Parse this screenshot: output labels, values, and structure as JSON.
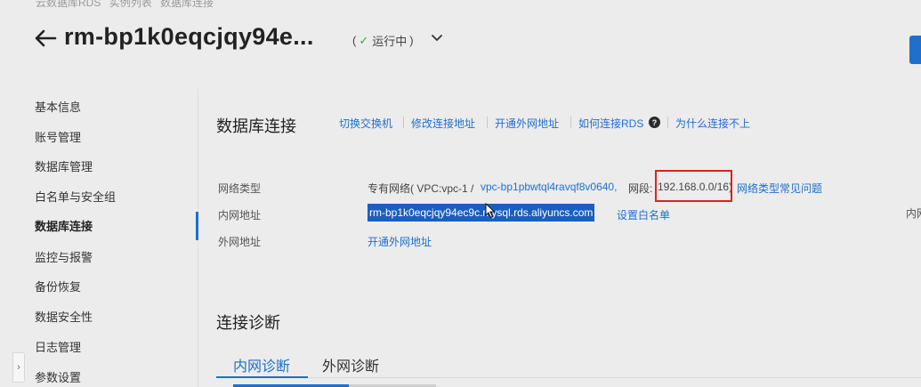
{
  "breadcrumb": [
    "云数据库RDS",
    "实例列表",
    "数据库连接"
  ],
  "header": {
    "title": "rm-bp1k0eqcjqy94e...",
    "status_prefix": "(",
    "status_label": "运行中",
    "status_suffix": ")",
    "status_color": "#2eae4a",
    "accent_color": "#1f6fcc"
  },
  "sidebar": {
    "items": [
      {
        "label": "基本信息"
      },
      {
        "label": "账号管理"
      },
      {
        "label": "数据库管理"
      },
      {
        "label": "白名单与安全组"
      },
      {
        "label": "数据库连接"
      },
      {
        "label": "监控与报警"
      },
      {
        "label": "备份恢复"
      },
      {
        "label": "数据安全性"
      },
      {
        "label": "日志管理"
      },
      {
        "label": "参数设置"
      }
    ],
    "active_item": "数据库连接",
    "collapse_icon": "chevron-right-icon"
  },
  "connection": {
    "title": "数据库连接",
    "actions": [
      "切换交换机",
      "修改连接地址",
      "开通外网地址",
      "如何连接RDS",
      "为什么连接不上"
    ],
    "help_icon_glyph": "?",
    "network_type_label": "网络类型",
    "network_type_prefix": "专有网络( VPC:vpc-1 /",
    "vpc_id": "vpc-bp1pbwtql4ravqf8v0640,",
    "segment_label": "网段:",
    "segment_value": "192.168.0.0/16",
    "segment_close": ")",
    "network_faq_link": "网络类型常见问题",
    "intranet_label": "内网地址",
    "intranet_address": "rm-bp1k0eqcjqy94ec9c.mysql.rds.aliyuncs.com",
    "set_whitelist_link": "设置白名单",
    "right_clipped_text": "内网",
    "internet_label": "外网地址",
    "open_internet_link": "开通外网地址"
  },
  "diagnosis": {
    "title": "连接诊断",
    "tabs": [
      {
        "label": "内网诊断",
        "active": true
      },
      {
        "label": "外网诊断",
        "active": false
      }
    ]
  }
}
